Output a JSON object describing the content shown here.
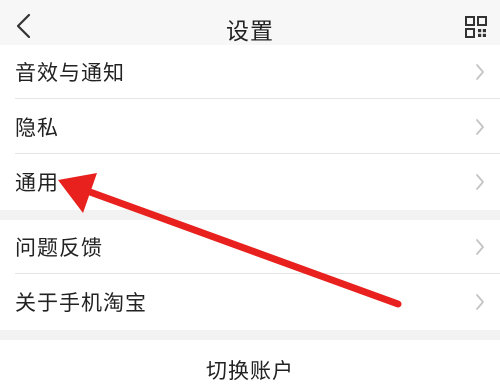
{
  "header": {
    "title": "设置",
    "back_icon": "chevron-left-icon",
    "grid_icon": "grid-menu-icon"
  },
  "groups": [
    {
      "items": [
        {
          "label": "音效与通知"
        },
        {
          "label": "隐私"
        },
        {
          "label": "通用"
        }
      ]
    },
    {
      "items": [
        {
          "label": "问题反馈"
        },
        {
          "label": "关于手机淘宝"
        }
      ]
    }
  ],
  "footer": {
    "switch_account_label": "切换账户"
  },
  "annotation": {
    "arrow_color": "#e8211e",
    "points_to": "通用"
  },
  "colors": {
    "background": "#f2f2f2",
    "header_bg": "#f7f7f7",
    "row_bg": "#ffffff",
    "chevron": "#c4c4c4"
  }
}
